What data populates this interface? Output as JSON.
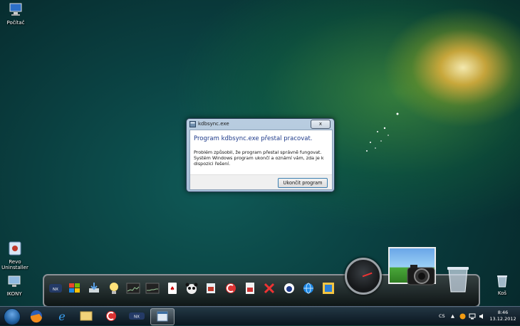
{
  "desktop": {
    "icons": [
      {
        "label": "Počítač"
      },
      {
        "label": "Revo Uninstaller"
      },
      {
        "label": "IKONY"
      },
      {
        "label": "Koš"
      }
    ]
  },
  "dialog": {
    "window_title": "kdbsync.exe",
    "close_label": "x",
    "heading": "Program kdbsync.exe přestal pracovat.",
    "message": "Problém způsobil, že program přestal správně fungovat. Systém Windows program ukončí a oznámí vám, zda je k dispozici řešení.",
    "button_label": "Ukončit program"
  },
  "dock": {
    "items": [
      "nexus-icon",
      "windows-logo-icon",
      "downloads-icon",
      "lightbulb-icon",
      "cpu-meter-icon",
      "memory-meter-icon",
      "solitaire-icon",
      "panda-icon",
      "tools-icon",
      "ccleaner-icon",
      "pdf-tool-icon",
      "remove-icon",
      "tor-icon",
      "internet-icon",
      "screen-icon",
      "clock-gauge-icon",
      "photo-icon",
      "camera-icon",
      "recycle-bin-icon"
    ]
  },
  "taskbar": {
    "apps": [
      "windows-start-icon",
      "firefox-icon",
      "internet-explorer-icon",
      "explorer-folder-icon",
      "ccleaner-icon",
      "nexus-icon",
      "active-window-icon"
    ],
    "language": "CS",
    "time": "8:46",
    "date": "13.12.2012"
  },
  "colors": {
    "dialog_heading": "#1e3a8a",
    "button_border": "#3c7fb1"
  }
}
